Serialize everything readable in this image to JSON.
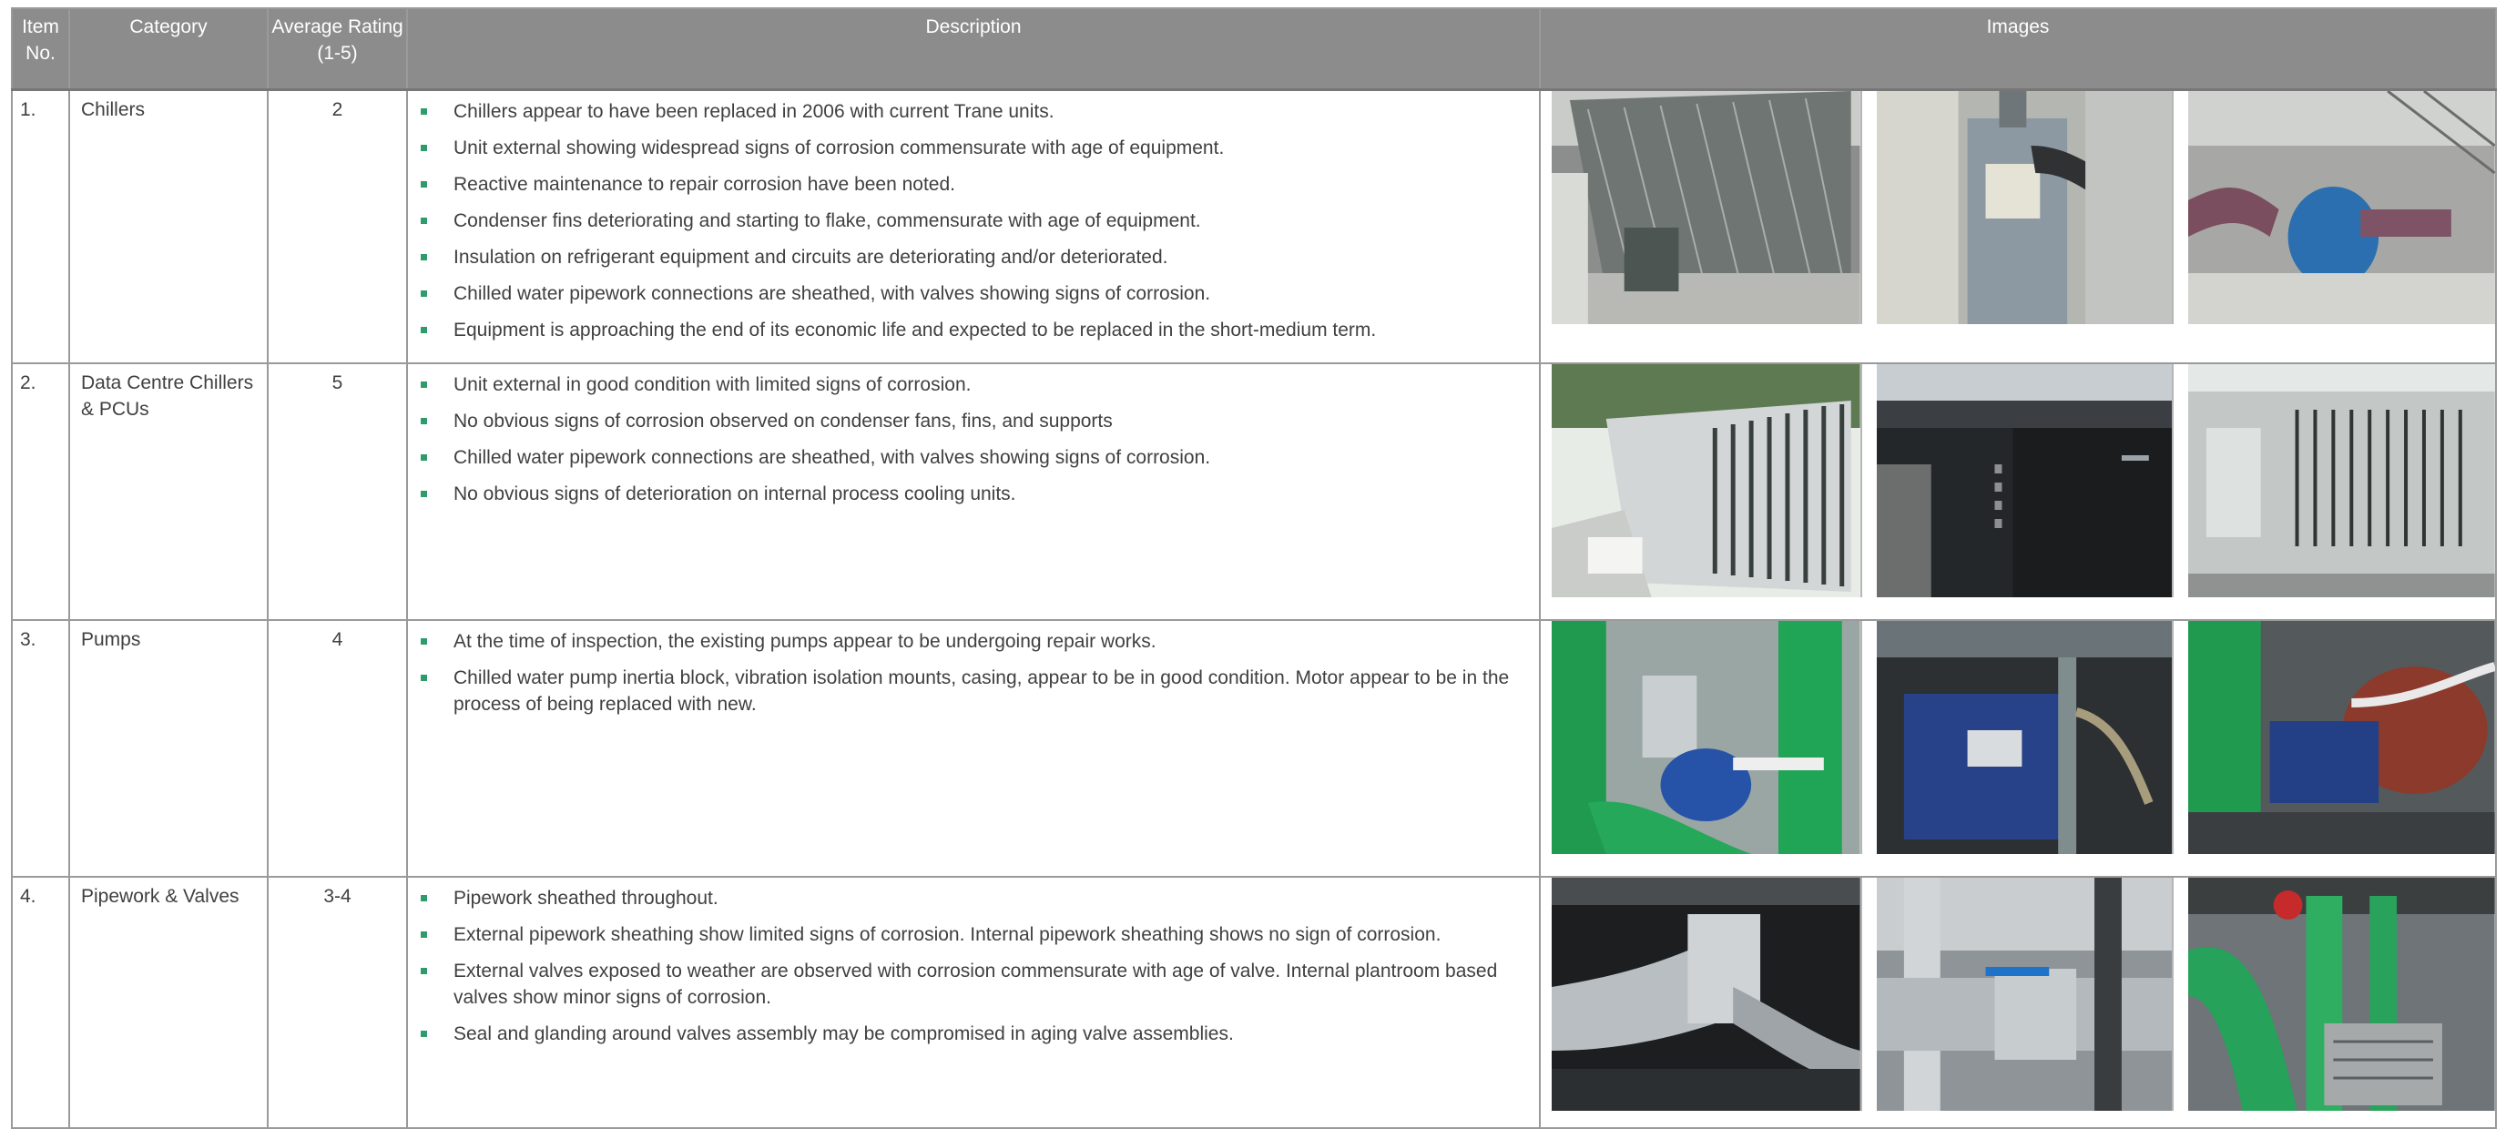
{
  "headers": {
    "item": "Item No.",
    "category": "Category",
    "rating": "Average Rating (1-5)",
    "description": "Description",
    "images": "Images"
  },
  "rows": [
    {
      "item": "1.",
      "category": "Chillers",
      "rating": "2",
      "bullets": [
        "Chillers appear to have been replaced in 2006 with current Trane units.",
        "Unit external showing widespread signs of corrosion commensurate with age of equipment.",
        "Reactive maintenance to repair corrosion have been noted.",
        "Condenser fins deteriorating and starting to flake, commensurate with age of equipment.",
        "Insulation on refrigerant equipment and circuits are deteriorating and/or deteriorated.",
        "Chilled water pipework connections are sheathed, with valves showing signs of corrosion.",
        "Equipment is approaching the end of its economic life and expected to be replaced in the short-medium term."
      ]
    },
    {
      "item": "2.",
      "category": "Data Centre Chillers & PCUs",
      "rating": "5",
      "bullets": [
        "Unit external in good condition with limited signs of corrosion.",
        "No obvious signs of corrosion observed on condenser fans, fins, and supports",
        "Chilled water pipework connections are sheathed, with valves showing signs of corrosion.",
        "No obvious signs of deterioration on internal process cooling units."
      ]
    },
    {
      "item": "3.",
      "category": "Pumps",
      "rating": "4",
      "bullets": [
        "At the time of inspection, the existing pumps appear to be undergoing repair works.",
        "Chilled water pump inertia block, vibration isolation mounts, casing, appear to be in good condition. Motor appear to be in the process of being replaced with new."
      ]
    },
    {
      "item": "4.",
      "category": "Pipework & Valves",
      "rating": "3-4",
      "bullets": [
        "Pipework sheathed throughout.",
        "External pipework sheathing show limited signs of corrosion. Internal pipework sheathing shows no sign of corrosion.",
        "External valves exposed to weather are observed with corrosion commensurate with age of valve. Internal plantroom based valves show minor signs of corrosion.",
        "Seal and glanding around valves assembly may be compromised in aging valve assemblies."
      ]
    }
  ],
  "colors": {
    "header_bg": "#8c8c8c",
    "header_text": "#ffffff",
    "bullet": "#2e9c6a",
    "border": "#9a9a9a"
  }
}
